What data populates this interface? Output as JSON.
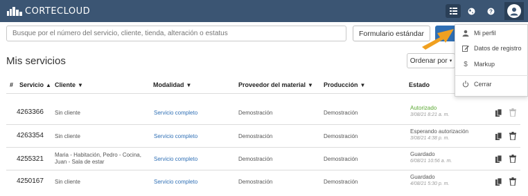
{
  "header": {
    "brand": "CORTECLOUD",
    "icons": [
      "cloud-logo-icon",
      "grid-icon",
      "globe-icon",
      "help-icon",
      "user-avatar-icon"
    ]
  },
  "search": {
    "placeholder": "Busque por el número del servicio, cliente, tienda, alteración o estatus",
    "form_button": "Formulario estándar"
  },
  "page": {
    "title": "Mis servicios",
    "order_button": "Ordenar por"
  },
  "table": {
    "columns": {
      "num": "#",
      "servicio": "Servicio",
      "cliente": "Cliente",
      "modalidad": "Modalidad",
      "proveedor": "Proveedor del material",
      "produccion": "Producción",
      "estado": "Estado"
    },
    "rows": [
      {
        "id": "4263366",
        "cliente": "Sin cliente",
        "cliente2": "",
        "modalidad": "Servicio completo",
        "proveedor": "Demostración",
        "produccion": "Demostración",
        "estado": "Autorizado",
        "fecha": "3/08/21 8:21 a. m.",
        "estado_color": "#5aa832"
      },
      {
        "id": "4263354",
        "cliente": "Sin cliente",
        "cliente2": "",
        "modalidad": "Servicio completo",
        "proveedor": "Demostración",
        "produccion": "Demostración",
        "estado": "Esperando autorización",
        "fecha": "3/08/21 4:38 p. m.",
        "estado_color": "#555555"
      },
      {
        "id": "4255321",
        "cliente": "Maria - Habitación, Pedro - Cocina,",
        "cliente2": "Juan - Sala de estar",
        "modalidad": "Servicio completo",
        "proveedor": "Demostración",
        "produccion": "Demostración",
        "estado": "Guardado",
        "fecha": "6/08/21 10:56 a. m.",
        "estado_color": "#555555"
      },
      {
        "id": "4250167",
        "cliente": "Sin cliente",
        "cliente2": "",
        "modalidad": "Servicio completo",
        "proveedor": "Demostración",
        "produccion": "Demostración",
        "estado": "Guardado",
        "fecha": "4/08/21 5:30 p. m.",
        "estado_color": "#555555"
      }
    ]
  },
  "menu": {
    "items": [
      {
        "label": "Mi perfil",
        "icon": "user-icon"
      },
      {
        "label": "Datos de registro",
        "icon": "edit-icon"
      },
      {
        "label": "Markup",
        "icon": "dollar-icon"
      },
      {
        "label": "Cerrar",
        "icon": "power-icon"
      }
    ]
  },
  "colors": {
    "header_bg": "#3b5573",
    "link": "#2f6fb5",
    "authorized": "#5aa832",
    "annotation_arrow": "#f0a020"
  }
}
